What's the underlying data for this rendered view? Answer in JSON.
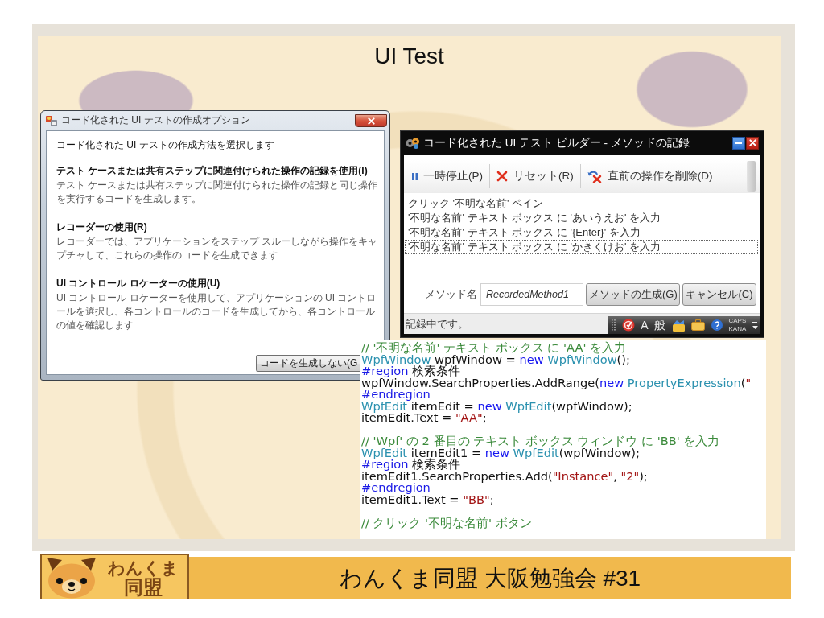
{
  "slide": {
    "title": "UI Test"
  },
  "options_dialog": {
    "title": "コード化された UI テストの作成オプション",
    "heading": "コード化された UI テストの作成方法を選択します",
    "options": [
      {
        "label": "テスト ケースまたは共有ステップに関連付けられた操作の記録を使用(I)",
        "description": "テスト ケースまたは共有ステップに関連付けられた操作の記録と同じ操作を実行するコードを生成します。"
      },
      {
        "label": "レコーダーの使用(R)",
        "description": "レコーダーでは、アプリケーションをステップ スルーしながら操作をキャプチャして、これらの操作のコードを生成できます"
      },
      {
        "label": "UI コントロール ロケーターの使用(U)",
        "description": "UI コントロール ロケーターを使用して、アプリケーションの UI コントロールを選択し、各コントロールのコードを生成してから、各コントロールの値を確認します"
      }
    ],
    "button": "コードを生成しない(G"
  },
  "builder_window": {
    "title": "コード化された UI テスト ビルダー - メソッドの記録",
    "toolbar": [
      "一時停止(P)",
      "リセット(R)",
      "直前の操作を削除(D)"
    ],
    "steps": [
      {
        "text": "クリック '不明な名前' ペイン",
        "selected": false
      },
      {
        "text": "'不明な名前' テキスト ボックス に 'あいうえお' を入力",
        "selected": false
      },
      {
        "text": "'不明な名前' テキスト ボックス に '{Enter}' を入力",
        "selected": false
      },
      {
        "text": "'不明な名前' テキスト ボックス に 'かきくけお' を入力",
        "selected": true
      }
    ],
    "method_label": "メソッド名",
    "method_name": "RecordedMethod1",
    "buttons": [
      "メソッドの生成(G)",
      "キャンセル(C)"
    ],
    "status": "記録中です。",
    "language_bar": {
      "input_mode": "A",
      "conversion_mode": "般",
      "caps": "CAPS",
      "kana": "KANA"
    }
  },
  "code": {
    "blocks": [
      {
        "lines": [
          [
            {
              "kind": "comment",
              "text": "// '不明な名前' テキスト ボックス に 'AA' を入力"
            }
          ],
          [
            {
              "kind": "type",
              "text": "WpfWindow"
            },
            {
              "kind": "plain",
              "text": " wpfWindow = "
            },
            {
              "kind": "keyword",
              "text": "new"
            },
            {
              "kind": "type",
              "text": " WpfWindow"
            },
            {
              "kind": "plain",
              "text": "();"
            }
          ],
          [
            {
              "kind": "directive",
              "text": "#region"
            },
            {
              "kind": "plain",
              "text": " 検索条件"
            }
          ],
          [
            {
              "kind": "plain",
              "text": "wpfWindow.SearchProperties.AddRange("
            },
            {
              "kind": "keyword",
              "text": "new"
            },
            {
              "kind": "type",
              "text": " PropertyExpression"
            },
            {
              "kind": "plain",
              "text": "("
            },
            {
              "kind": "string",
              "text": "\""
            }
          ],
          [
            {
              "kind": "directive",
              "text": "#endregion"
            }
          ],
          [
            {
              "kind": "type",
              "text": "WpfEdit"
            },
            {
              "kind": "plain",
              "text": " itemEdit = "
            },
            {
              "kind": "keyword",
              "text": "new"
            },
            {
              "kind": "type",
              "text": " WpfEdit"
            },
            {
              "kind": "plain",
              "text": "(wpfWindow);"
            }
          ],
          [
            {
              "kind": "plain",
              "text": "itemEdit.Text = "
            },
            {
              "kind": "string",
              "text": "\"AA\""
            },
            {
              "kind": "plain",
              "text": ";"
            }
          ]
        ]
      },
      {
        "lines": [
          [
            {
              "kind": "comment",
              "text": "// 'Wpf' の 2 番目の テキスト ボックス ウィンドウ に 'BB' を入力"
            }
          ],
          [
            {
              "kind": "type",
              "text": "WpfEdit"
            },
            {
              "kind": "plain",
              "text": " itemEdit1 = "
            },
            {
              "kind": "keyword",
              "text": "new"
            },
            {
              "kind": "type",
              "text": " WpfEdit"
            },
            {
              "kind": "plain",
              "text": "(wpfWindow);"
            }
          ],
          [
            {
              "kind": "directive",
              "text": "#region"
            },
            {
              "kind": "plain",
              "text": " 検索条件"
            }
          ],
          [
            {
              "kind": "plain",
              "text": "itemEdit1.SearchProperties.Add("
            },
            {
              "kind": "string",
              "text": "\"Instance\""
            },
            {
              "kind": "plain",
              "text": ", "
            },
            {
              "kind": "string",
              "text": "\"2\""
            },
            {
              "kind": "plain",
              "text": ");"
            }
          ],
          [
            {
              "kind": "directive",
              "text": "#endregion"
            }
          ],
          [
            {
              "kind": "plain",
              "text": "itemEdit1.Text = "
            },
            {
              "kind": "string",
              "text": "\"BB\""
            },
            {
              "kind": "plain",
              "text": ";"
            }
          ]
        ]
      },
      {
        "lines": [
          [
            {
              "kind": "comment",
              "text": "// クリック '不明な名前' ボタン"
            }
          ]
        ]
      }
    ]
  },
  "footer": {
    "logo": [
      "わんくま",
      "同盟"
    ],
    "title": "わんくま同盟 大阪勉強会 #31"
  }
}
